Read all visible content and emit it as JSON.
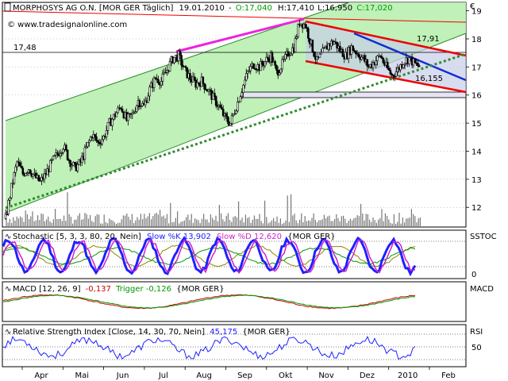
{
  "header": {
    "title": "MORPHOSYS AG O.N. [MOR GER  Täglich]",
    "date": "19.01.2010",
    "ohlc_sep": "-",
    "open": "O:17,040",
    "high": "H:17,410",
    "low": "L:16,950",
    "close": "C:17,020",
    "currency": "€",
    "watermark": "© www.tradesignalonline.com"
  },
  "colors": {
    "channel_fill": "#b8f0b0",
    "channel_line": "#2e8b2e",
    "support_dotted": "#2e8b2e",
    "magenta": "#ee22dd",
    "red": "#ee0000",
    "blue": "#1030d0",
    "stoch_k": "#2020ff",
    "stoch_d": "#cc22cc",
    "macd_line": "#cc0000",
    "macd_trigger": "#009900",
    "rsi_line": "#2020ff"
  },
  "annotations": {
    "hline_label": "17,48",
    "upper_label": "17,91",
    "lower_label": "16,155"
  },
  "panels": {
    "stochastic": {
      "label": "Stochastic [5, 3, 3, 80, 20, Nein]",
      "k_label": "Slow %K 13,902",
      "d_label": "Slow %D 12,620",
      "suffix": "{MOR GER}",
      "name": "SSTOC",
      "tick": "0"
    },
    "macd": {
      "label": "MACD [12, 26, 9]",
      "value": "-0,137",
      "trigger": "Trigger -0,126",
      "suffix": "{MOR GER}",
      "name": "MACD"
    },
    "rsi": {
      "label": "Relative Strength Index [Close, 14, 30, 70, Nein]",
      "value": "45,175",
      "suffix": "{MOR GER}",
      "name": "RSI",
      "tick": "50"
    }
  },
  "chart_data": {
    "type": "candlestick",
    "ylim": [
      11.3,
      19.3
    ],
    "y_ticks": [
      12,
      13,
      14,
      15,
      16,
      17,
      18,
      19
    ],
    "x_labels": [
      "Apr",
      "Mai",
      "Jun",
      "Jul",
      "Aug",
      "Sep",
      "Okt",
      "Nov",
      "Dez",
      "2010",
      "Feb"
    ],
    "series": [
      {
        "values": [
          11.6,
          12.7,
          13.6,
          13.2,
          13.4,
          13.1,
          12.9,
          13.2,
          13.6,
          13.9,
          14.2,
          13.7,
          13.4,
          13.6,
          14.1,
          14.6,
          14.3,
          14.5,
          15.0,
          15.3,
          15.6,
          15.1,
          15.3,
          15.8,
          15.6,
          16.2,
          16.6,
          16.5,
          16.9,
          17.3,
          17.4,
          16.9,
          16.6,
          16.4,
          16.5,
          16.2,
          15.9,
          15.6,
          15.2,
          15.0,
          15.6,
          16.2,
          16.8,
          17.1,
          17.0,
          17.2,
          17.4,
          16.8,
          17.1,
          17.5,
          17.7,
          18.6,
          18.5,
          17.8,
          17.2,
          17.5,
          17.8,
          17.9,
          17.6,
          17.4,
          17.7,
          17.5,
          17.3,
          17.0,
          17.2,
          17.4,
          17.0,
          16.7,
          16.9,
          17.2,
          17.3,
          17.1,
          17.0
        ]
      }
    ]
  }
}
